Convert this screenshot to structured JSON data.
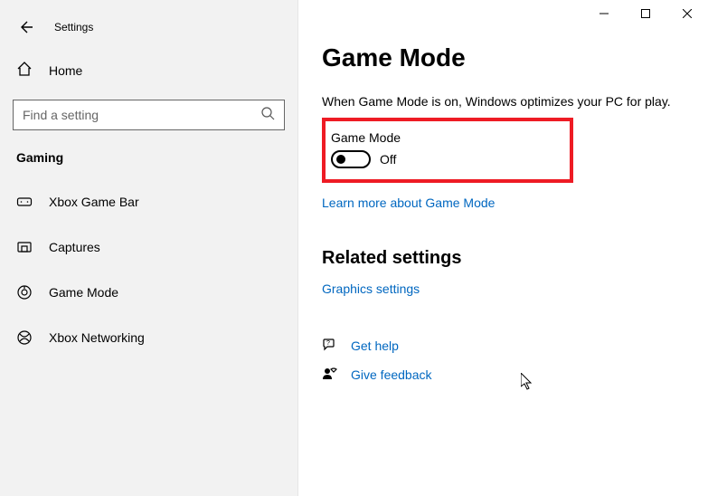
{
  "window": {
    "title": "Settings"
  },
  "sidebar": {
    "home": "Home",
    "search_placeholder": "Find a setting",
    "category": "Gaming",
    "items": [
      {
        "label": "Xbox Game Bar"
      },
      {
        "label": "Captures"
      },
      {
        "label": "Game Mode"
      },
      {
        "label": "Xbox Networking"
      }
    ]
  },
  "page": {
    "title": "Game Mode",
    "description": "When Game Mode is on, Windows optimizes your PC for play.",
    "toggle_label": "Game Mode",
    "toggle_state": "Off",
    "learn_more": "Learn more about Game Mode",
    "related_header": "Related settings",
    "graphics_link": "Graphics settings",
    "get_help": "Get help",
    "give_feedback": "Give feedback"
  }
}
